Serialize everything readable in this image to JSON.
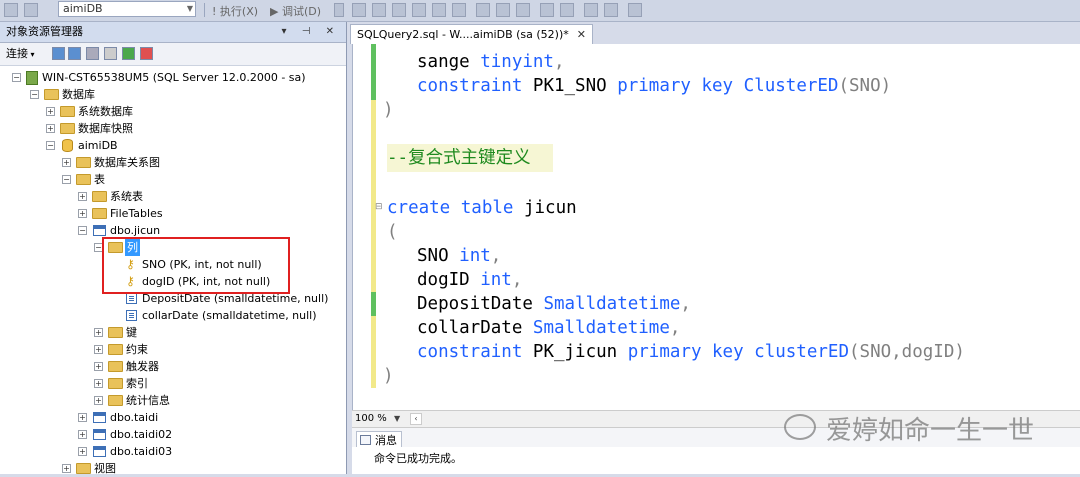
{
  "toolbar": {
    "database_combo": "aimiDB",
    "execute_label": "执行(X)",
    "debug_label": "调试(D)"
  },
  "object_explorer": {
    "title": "对象资源管理器",
    "pin_glyphs": "▾ ⊣ ✕",
    "connect_label": "连接",
    "tree": {
      "server": "WIN-CST65538UM5 (SQL Server 12.0.2000 - sa)",
      "databases": "数据库",
      "system_databases": "系统数据库",
      "database_snapshots": "数据库快照",
      "aimidb": "aimiDB",
      "db_diagrams": "数据库关系图",
      "tables": "表",
      "system_tables": "系统表",
      "filetables": "FileTables",
      "dbo_jicun": "dbo.jicun",
      "columns": "列",
      "col_sno": "SNO (PK, int, not null)",
      "col_dogid": "dogID (PK, int, not null)",
      "col_depositdate": "DepositDate (smalldatetime, null)",
      "col_collardate": "collarDate (smalldatetime, null)",
      "keys": "键",
      "constraints": "约束",
      "triggers": "触发器",
      "indexes": "索引",
      "statistics": "统计信息",
      "dbo_taidi": "dbo.taidi",
      "dbo_taidi02": "dbo.taidi02",
      "dbo_taidi03": "dbo.taidi03",
      "views": "视图"
    }
  },
  "editor": {
    "tab_label": "SQLQuery2.sql - W....aimiDB (sa (52))*",
    "tab_close": "✕",
    "code": {
      "l1_ident": "sange ",
      "l1_type": "tinyint",
      "l1_comma": ",",
      "l2_kw1": "constraint ",
      "l2_name": "PK1_SNO ",
      "l2_kw2": "primary key ClusterED",
      "l2_args": "(SNO)",
      "l3": ")",
      "comment": "--复合式主键定义",
      "l5_kw": "create table ",
      "l5_name": "jicun",
      "l6": "(",
      "l7_ident": "SNO ",
      "l7_type": "int",
      "l8_ident": "dogID ",
      "l8_type": "int",
      "l9_ident": "DepositDate ",
      "l9_type": "Smalldatetime",
      "l10_ident": "collarDate ",
      "l10_type": "Smalldatetime",
      "l11_kw1": "constraint ",
      "l11_name": "PK_jicun ",
      "l11_kw2": "primary key clusterED",
      "l11_args": "(SNO,dogID)",
      "l12": ")",
      "comma": ","
    },
    "zoom": "100 %"
  },
  "results": {
    "messages_tab": "消息",
    "message": "命令已成功完成。"
  },
  "watermark": "爱婷如命一生一世"
}
